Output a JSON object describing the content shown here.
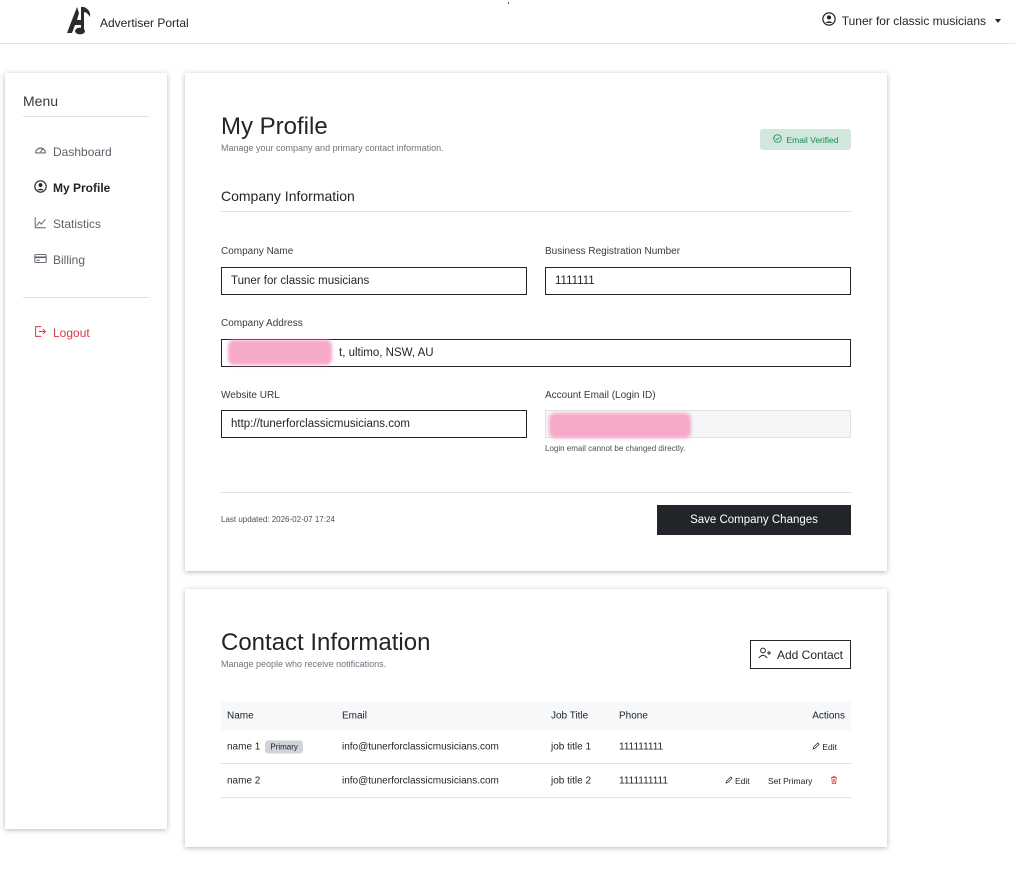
{
  "header": {
    "brand": "Advertiser Portal",
    "user_name": "Tuner for classic musicians"
  },
  "sidebar": {
    "title": "Menu",
    "items": [
      {
        "label": "Dashboard",
        "icon": "gauge-icon"
      },
      {
        "label": "My Profile",
        "icon": "user-circle-icon",
        "active": true
      },
      {
        "label": "Statistics",
        "icon": "chart-line-icon"
      },
      {
        "label": "Billing",
        "icon": "credit-card-icon"
      }
    ],
    "logout": "Logout"
  },
  "profile": {
    "title": "My Profile",
    "subtitle": "Manage your company and primary contact information.",
    "badge": "Email Verified",
    "section_title": "Company Information",
    "company_name_label": "Company Name",
    "company_name": "Tuner for classic musicians",
    "brn_label": "Business Registration Number",
    "brn": "1111111",
    "address_label": "Company Address",
    "address_visible": "t, ultimo, NSW, AU",
    "website_label": "Website URL",
    "website": "http://tunerforclassicmusicians.com",
    "email_label": "Account Email (Login ID)",
    "email_help": "Login email cannot be changed directly.",
    "last_updated": "Last updated: 2026-02-07 17:24",
    "save_label": "Save Company Changes"
  },
  "contacts": {
    "title": "Contact Information",
    "subtitle": "Manage people who receive notifications.",
    "add_label": "Add Contact",
    "columns": {
      "name": "Name",
      "email": "Email",
      "job": "Job Title",
      "phone": "Phone",
      "actions": "Actions"
    },
    "rows": [
      {
        "name": "name 1",
        "badge": "Primary",
        "email": "info@tunerforclassicmusicians.com",
        "job": "job title 1",
        "phone": "111111111",
        "edit": "Edit"
      },
      {
        "name": "name 2",
        "email": "info@tunerforclassicmusicians.com",
        "job": "job title 2",
        "phone": "1111111111",
        "edit": "Edit",
        "set_primary": "Set Primary"
      }
    ]
  },
  "colors": {
    "danger": "#dc3545",
    "success": "#198754",
    "dark": "#212529"
  }
}
